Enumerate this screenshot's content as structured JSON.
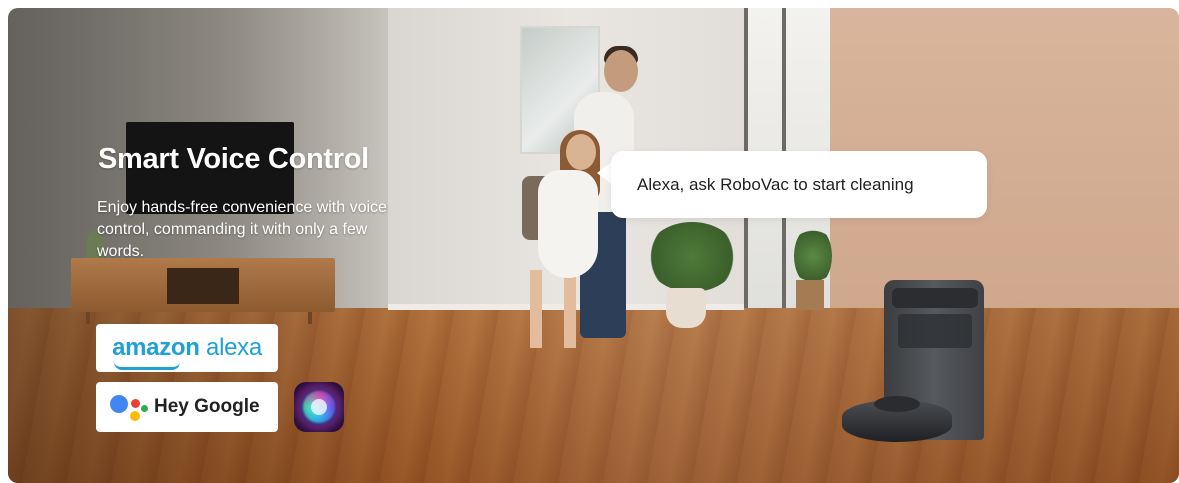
{
  "banner": {
    "title": "Smart Voice Control",
    "description": "Enjoy hands-free convenience with voice control, commanding it with only a few words.",
    "speech_bubble": "Alexa, ask RoboVac to start cleaning"
  },
  "assistants": {
    "alexa": {
      "word1": "amazon",
      "word2": "alexa",
      "icon": "amazon-alexa-logo"
    },
    "google": {
      "label": "Hey Google",
      "icon": "google-assistant-dots-icon"
    },
    "siri": {
      "icon": "siri-icon"
    }
  },
  "colors": {
    "alexa_blue": "#1fa1d6",
    "google_blue": "#4285f4",
    "google_red": "#ea4335",
    "google_yellow": "#fbbc05",
    "google_green": "#34a853"
  }
}
